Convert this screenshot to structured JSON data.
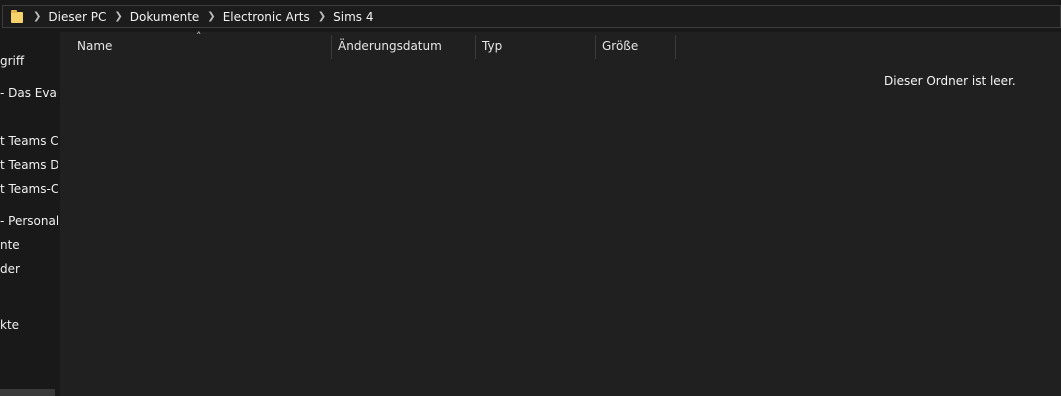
{
  "address": {
    "breadcrumbs": [
      "Dieser PC",
      "Dokumente",
      "Electronic Arts",
      "Sims 4"
    ]
  },
  "sidebar": {
    "items": [
      "griff",
      "- Das Evang",
      "t Teams Ch",
      "t Teams Da",
      "t Teams-Cl",
      "- Personal",
      "nte",
      "der",
      "kte"
    ]
  },
  "columns": {
    "name": "Name",
    "modified": "Änderungsdatum",
    "type": "Typ",
    "size": "Größe"
  },
  "empty_message": "Dieser Ordner ist leer.",
  "colors": {
    "background": "#202020",
    "sidebar": "#191919",
    "folder": "#f7d26a"
  }
}
